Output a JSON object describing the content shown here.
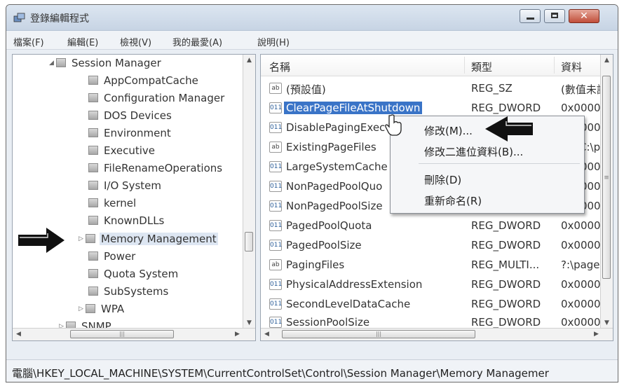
{
  "window": {
    "title": "登錄編輯程式"
  },
  "menu": [
    "檔案(F)",
    "編輯(E)",
    "檢視(V)",
    "我的最愛(A)",
    "說明(H)"
  ],
  "tree": {
    "items": [
      {
        "label": "Session Manager",
        "expanded": true
      },
      {
        "label": "AppCompatCache"
      },
      {
        "label": "Configuration Manager"
      },
      {
        "label": "DOS Devices"
      },
      {
        "label": "Environment"
      },
      {
        "label": "Executive"
      },
      {
        "label": "FileRenameOperations"
      },
      {
        "label": "I/O System"
      },
      {
        "label": "kernel"
      },
      {
        "label": "KnownDLLs"
      },
      {
        "label": "Memory Management",
        "selected": true
      },
      {
        "label": "Power"
      },
      {
        "label": "Quota System"
      },
      {
        "label": "SubSystems"
      },
      {
        "label": "WPA"
      },
      {
        "label": "SNMP"
      }
    ]
  },
  "list": {
    "headers": {
      "name": "名稱",
      "type": "類型",
      "data": "資料"
    },
    "rows": [
      {
        "icon": "ab",
        "name": "(預設值)",
        "type": "REG_SZ",
        "data": "(數值未設"
      },
      {
        "icon": "bin",
        "name": "ClearPageFileAtShutdown",
        "type": "REG_DWORD",
        "data": "0x00000",
        "selected": true
      },
      {
        "icon": "bin",
        "name": "DisablePagingExec",
        "type": "",
        "data": "0x00000"
      },
      {
        "icon": "ab",
        "name": "ExistingPageFiles",
        "type": "",
        "data": "\\??\\C:\\p"
      },
      {
        "icon": "bin",
        "name": "LargeSystemCache",
        "type": "",
        "data": "0x00000"
      },
      {
        "icon": "bin",
        "name": "NonPagedPoolQuo",
        "type": "",
        "data": "0x00000"
      },
      {
        "icon": "bin",
        "name": "NonPagedPoolSize",
        "type": "",
        "data": "0x00000"
      },
      {
        "icon": "bin",
        "name": "PagedPoolQuota",
        "type": "REG_DWORD",
        "data": "0x00000"
      },
      {
        "icon": "bin",
        "name": "PagedPoolSize",
        "type": "REG_DWORD",
        "data": "0x00000"
      },
      {
        "icon": "ab",
        "name": "PagingFiles",
        "type": "REG_MULTI...",
        "data": "?:\\page"
      },
      {
        "icon": "bin",
        "name": "PhysicalAddressExtension",
        "type": "REG_DWORD",
        "data": "0x00000"
      },
      {
        "icon": "bin",
        "name": "SecondLevelDataCache",
        "type": "REG_DWORD",
        "data": "0x00000"
      },
      {
        "icon": "bin",
        "name": "SessionPoolSize",
        "type": "REG_DWORD",
        "data": "0x00000"
      }
    ]
  },
  "context_menu": {
    "items": [
      "修改(M)...",
      "修改二進位資料(B)...",
      "刪除(D)",
      "重新命名(R)"
    ]
  },
  "status": "電腦\\HKEY_LOCAL_MACHINE\\SYSTEM\\CurrentControlSet\\Control\\Session Manager\\Memory Managemer",
  "icons": {
    "ab": "ab",
    "bin": "011"
  },
  "colors": {
    "selection": "#3a74c7",
    "accent_title": "#c7d4e4"
  }
}
